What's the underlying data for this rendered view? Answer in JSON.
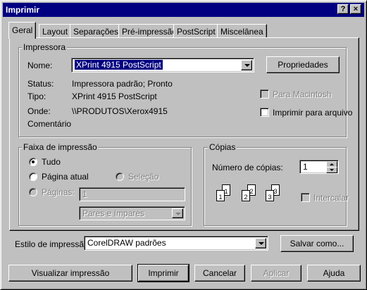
{
  "window": {
    "title": "Imprimir",
    "help_glyph": "?",
    "close_glyph": "×"
  },
  "tabs": [
    {
      "label": "Geral",
      "active": true
    },
    {
      "label": "Layout"
    },
    {
      "label": "Separações"
    },
    {
      "label": "Pré-impressão"
    },
    {
      "label": "PostScript"
    },
    {
      "label": "Miscelânea"
    }
  ],
  "printer": {
    "group_label": "Impressora",
    "name_label": "Nome:",
    "name_value": "XPrint 4915 PostScript",
    "properties_button": "Propriedades",
    "status_label": "Status:",
    "status_value": "Impressora padrão; Pronto",
    "type_label": "Tipo:",
    "type_value": "XPrint 4915 PostScript",
    "where_label": "Onde:",
    "where_value": "\\\\PRODUTOS\\Xerox4915",
    "comment_label": "Comentário",
    "for_mac_label": "Para Macintosh",
    "print_to_file_label": "Imprimir para arquivo"
  },
  "range": {
    "group_label": "Faixa de impressão",
    "all_label": "Tudo",
    "current_page_label": "Página atual",
    "selection_label": "Seleção",
    "pages_label": "Páginas:",
    "pages_value": "1",
    "odd_even_value": "Pares e ímpares"
  },
  "copies": {
    "group_label": "Cópias",
    "count_label": "Número de cópias:",
    "count_value": "1",
    "collate_label": "Intercalar",
    "collate_icon_numbers": [
      "1",
      "1",
      "2",
      "2",
      "3",
      "3"
    ]
  },
  "style": {
    "label": "Estilo de impressão:",
    "value": "CorelDRAW padrões",
    "save_button": "Salvar como..."
  },
  "footer": {
    "preview_button": "Visualizar impressão",
    "print_button": "Imprimir",
    "cancel_button": "Cancelar",
    "apply_button": "Aplicar",
    "help_button": "Ajuda"
  }
}
